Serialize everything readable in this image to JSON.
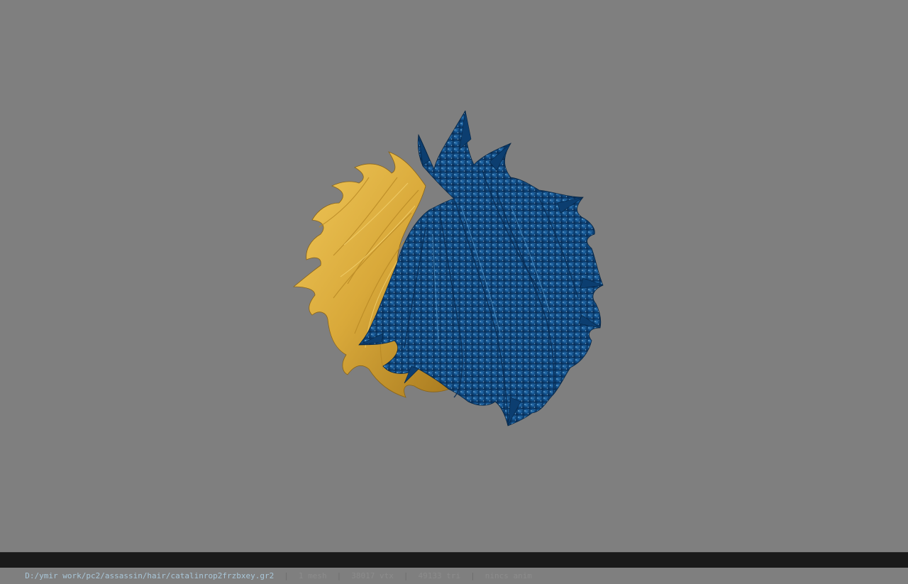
{
  "viewer": {
    "background_color": "#7f7f7f",
    "model_name": "hair-mesh",
    "colors": {
      "blond_hair": "#d9a93a",
      "blond_highlight": "#f0c85a",
      "blond_shadow": "#a87a1f",
      "blue_hair": "#0f4a82",
      "blue_highlight": "#3e86c4",
      "blue_shadow": "#082c54"
    }
  },
  "statusbar": {
    "file_path": "D:/ymir work/pc2/assassin/hair/catalinrop2frzbxey.gr2",
    "mesh_count": "1 mesh",
    "vertex_count": "38017 vtx",
    "triangle_count": "49133 tri",
    "anim_info": "nincs anim",
    "separator": "|"
  }
}
